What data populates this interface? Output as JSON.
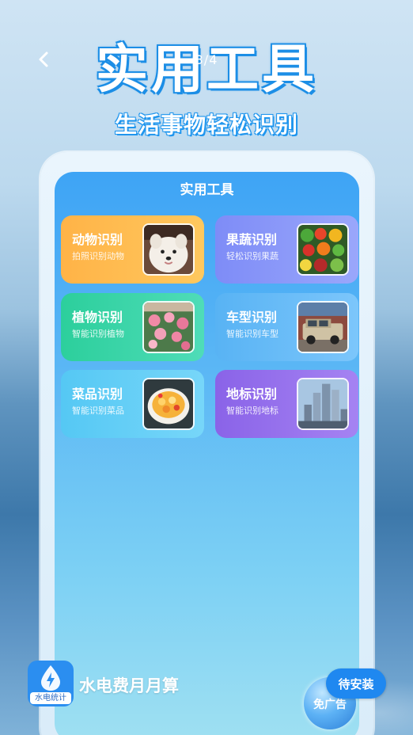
{
  "header": {
    "title": "实用工具",
    "page_counter": "3/4",
    "subtitle": "生活事物轻松识别"
  },
  "phone_screen": {
    "title": "实用工具",
    "cards": [
      {
        "label": "动物识别",
        "desc": "拍照识别动物",
        "image": "samoyed-dog-photo",
        "color": "#ffb347"
      },
      {
        "label": "果蔬识别",
        "desc": "轻松识别果蔬",
        "image": "fruits-vegetables-photo",
        "color": "#7e8cf7"
      },
      {
        "label": "植物识别",
        "desc": "智能识别植物",
        "image": "pink-flowers-photo",
        "color": "#2ccf9c"
      },
      {
        "label": "车型识别",
        "desc": "智能识别车型",
        "image": "land-cruiser-car-photo",
        "color": "#58b3f4"
      },
      {
        "label": "菜品识别",
        "desc": "智能识别菜品",
        "image": "dessert-bowl-photo",
        "color": "#55c8f4"
      },
      {
        "label": "地标识别",
        "desc": "智能识别地标",
        "image": "city-skyscrapers-photo",
        "color": "#8a63e8"
      }
    ]
  },
  "footer": {
    "app_icon_label": "水电统计",
    "app_name": "水电费月月算",
    "no_ad_label": "免广告",
    "install_label": "待安装"
  },
  "icons": {
    "back": "chevron-left-icon",
    "app": "water-drop-lightning-icon"
  },
  "colors": {
    "title_stroke": "#1e8fe6",
    "install_button": "#1f88f0"
  }
}
